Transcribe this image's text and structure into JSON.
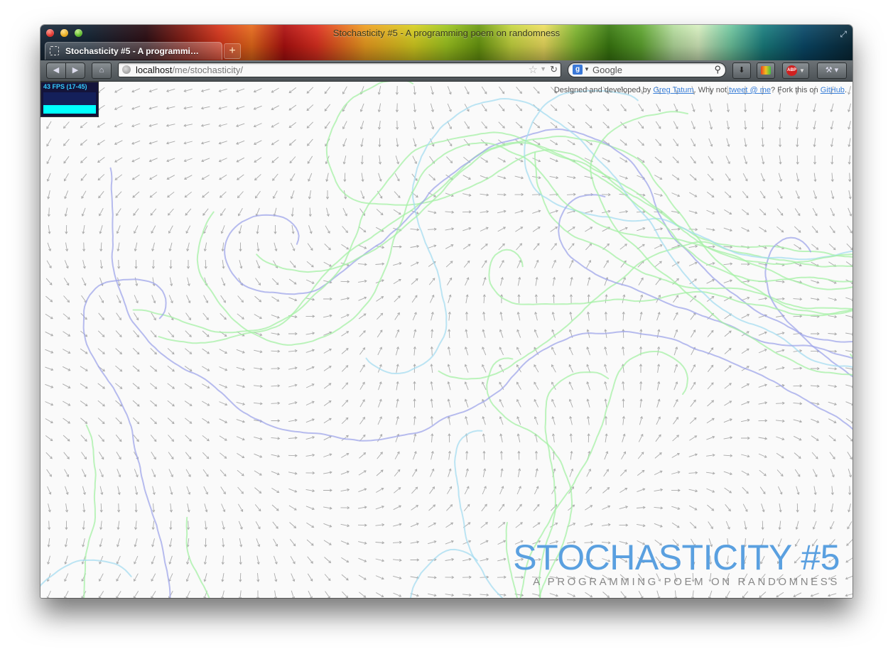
{
  "window": {
    "title": "Stochasticity #5 - A programming poem on randomness"
  },
  "tab": {
    "title": "Stochasticity #5 - A programmi…"
  },
  "toolbar": {
    "back_icon": "back-arrow-icon",
    "forward_icon": "forward-arrow-icon",
    "home_icon": "home-icon",
    "url_host": "localhost",
    "url_path": "/me/stochasticity/",
    "search_engine_label": "g",
    "search_placeholder": "Google"
  },
  "stats": {
    "fps_label": "43 FPS (17-45)",
    "fps_fraction": 0.4
  },
  "credits": {
    "prefix": "Designed and developed by ",
    "author_link": "Greg Tatum",
    "middle": ". Why not ",
    "tweet_link": "tweet @ me",
    "fork_text": "? Fork this on ",
    "github_link": "GitHub",
    "suffix": "."
  },
  "hero": {
    "title": "STOCHASTICITY #5",
    "subtitle": "A PROGRAMMING POEM ON RANDOMNESS"
  },
  "colors": {
    "title_blue": "#5aa0e0",
    "arrow_gray": "#aaaaaa",
    "line_green": "#a6f0a6",
    "line_blue": "#9fa6ea",
    "line_cyan": "#a6dcf0"
  }
}
